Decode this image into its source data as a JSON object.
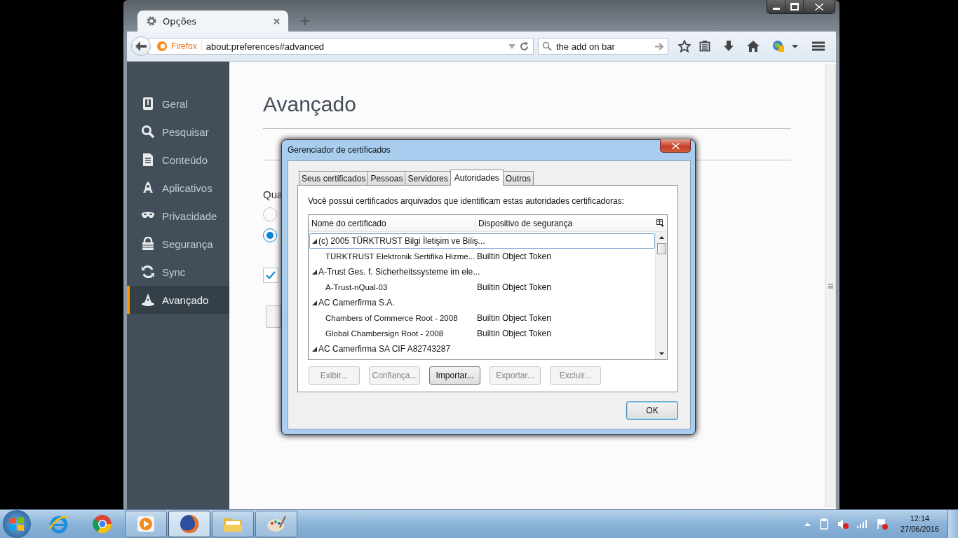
{
  "browser": {
    "tab": {
      "title": "Opções"
    },
    "identity": "Firefox",
    "url": "about:preferences#advanced",
    "search": {
      "value": "the add on bar"
    }
  },
  "sidebar": {
    "items": [
      {
        "label": "Geral",
        "selected": false
      },
      {
        "label": "Pesquisar",
        "selected": false
      },
      {
        "label": "Conteúdo",
        "selected": false
      },
      {
        "label": "Aplicativos",
        "selected": false
      },
      {
        "label": "Privacidade",
        "selected": false
      },
      {
        "label": "Segurança",
        "selected": false
      },
      {
        "label": "Sync",
        "selected": false
      },
      {
        "label": "Avançado",
        "selected": true
      }
    ]
  },
  "page": {
    "title": "Avançado",
    "partial_label": "Qua",
    "radios": [
      {
        "selected": false
      },
      {
        "selected": true
      }
    ],
    "checkbox": {
      "checked": true
    }
  },
  "dialog": {
    "title": "Gerenciador de certificados",
    "tabs": [
      {
        "label": "Seus certificados",
        "selected": false
      },
      {
        "label": "Pessoas",
        "selected": false
      },
      {
        "label": "Servidores",
        "selected": false
      },
      {
        "label": "Autoridades",
        "selected": true
      },
      {
        "label": "Outros",
        "selected": false
      }
    ],
    "intro": "Você possui certificados arquivados que identificam estas autoridades certificadoras:",
    "columns": [
      "Nome do certificado",
      "Dispositivo de segurança"
    ],
    "rows": [
      {
        "name": "(c) 2005 TÜRKTRUST Bilgi İletişim ve Biliş...",
        "expanded": true,
        "selected": true,
        "children": [
          {
            "name": "TÜRKTRUST Elektronik Sertifika Hizme...",
            "device": "Builtin Object Token"
          }
        ]
      },
      {
        "name": "A-Trust Ges. f. Sicherheitssysteme im ele...",
        "expanded": true,
        "selected": false,
        "children": [
          {
            "name": "A-Trust-nQual-03",
            "device": "Builtin Object Token"
          }
        ]
      },
      {
        "name": "AC Camerfirma S.A.",
        "expanded": true,
        "selected": false,
        "children": [
          {
            "name": "Chambers of Commerce Root - 2008",
            "device": "Builtin Object Token"
          },
          {
            "name": "Global Chambersign Root - 2008",
            "device": "Builtin Object Token"
          }
        ]
      },
      {
        "name": "AC Camerfirma SA CIF A82743287",
        "expanded": true,
        "selected": false,
        "children": []
      }
    ],
    "buttons": [
      {
        "label": "Exibir...",
        "disabled": true
      },
      {
        "label": "Confiança...",
        "disabled": true
      },
      {
        "label": "Importar...",
        "disabled": false
      },
      {
        "label": "Exportar...",
        "disabled": true
      },
      {
        "label": "Excluir...",
        "disabled": true
      }
    ],
    "ok": "OK"
  },
  "taskbar": {
    "apps": [
      {
        "kind": "ie",
        "running": false,
        "active": false
      },
      {
        "kind": "chrome",
        "running": false,
        "active": false
      },
      {
        "kind": "media",
        "running": true,
        "active": false
      },
      {
        "kind": "firefox",
        "running": true,
        "active": true
      },
      {
        "kind": "folder",
        "running": true,
        "active": false
      },
      {
        "kind": "paint",
        "running": true,
        "active": false
      }
    ],
    "clock": {
      "time": "12:14",
      "date": "27/06/2016"
    }
  }
}
